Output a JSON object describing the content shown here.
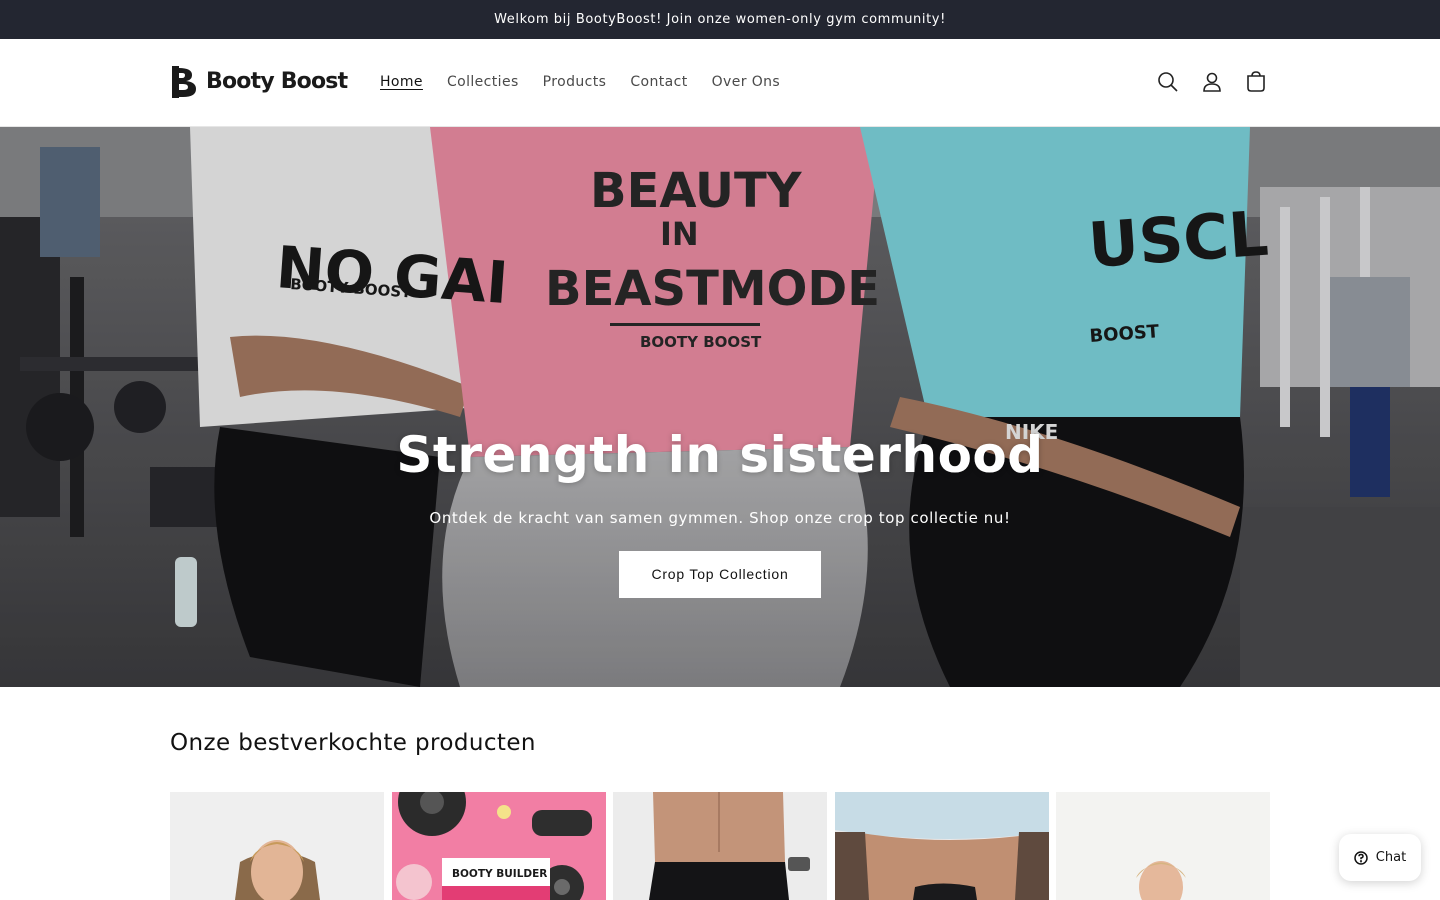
{
  "announcement": {
    "text": "Welkom bij BootyBoost! Join onze women-only gym community!"
  },
  "header": {
    "logo_text": "Booty Boost",
    "nav": [
      {
        "label": "Home",
        "active": true
      },
      {
        "label": "Collecties",
        "active": false
      },
      {
        "label": "Products",
        "active": false
      },
      {
        "label": "Contact",
        "active": false
      },
      {
        "label": "Over Ons",
        "active": false
      }
    ],
    "icons": [
      "search-icon",
      "account-icon",
      "cart-icon"
    ]
  },
  "hero": {
    "title": "Strength in sisterhood",
    "subtitle": "Ontdek de kracht van samen gymmen. Shop onze crop top collectie nu!",
    "button_label": "Crop Top Collection",
    "shirt_prints": {
      "left": "NO GAI",
      "center_line1": "BEAUTY",
      "center_line2": "IN",
      "center_line3": "BEASTMODE",
      "center_brand": "BOOTY BOOST",
      "right": "USCL",
      "right_brand": "BOOST",
      "left_brand": "BOOTY BOOST",
      "nike": "NIKE"
    }
  },
  "bestsellers": {
    "title": "Onze bestverkochte producten",
    "products": [
      {
        "image": "woman-portrait",
        "print": ""
      },
      {
        "image": "booty-builder-guide",
        "print": "BOOTY BUILDER"
      },
      {
        "image": "black-leggings",
        "print": ""
      },
      {
        "image": "crop-top-tattoo",
        "print": ""
      },
      {
        "image": "woman-white-background",
        "print": ""
      }
    ]
  },
  "chat": {
    "label": "Chat"
  },
  "colors": {
    "announcement_bg": "#232631",
    "hero_button_bg": "#ffffff",
    "pink_shirt": "#f08fa6",
    "blue_shirt": "#7fd6e0"
  }
}
